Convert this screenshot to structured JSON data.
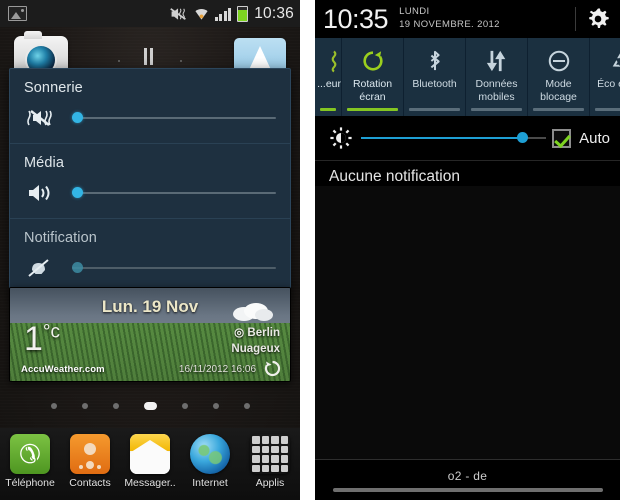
{
  "left_phone": {
    "status_bar": {
      "icons": [
        "image-icon",
        "vibrate-mute-icon",
        "wifi-icon",
        "signal-icon",
        "battery-icon"
      ],
      "clock": "10:36"
    },
    "home_icons": [
      {
        "name": "camera-icon",
        "label": ""
      },
      {
        "name": "navigation-icon",
        "label": ""
      }
    ],
    "volume_panel": {
      "rows": [
        {
          "label": "Sonnerie",
          "icon": "vibrate-mute-icon",
          "value": 4,
          "disabled": false
        },
        {
          "label": "Média",
          "icon": "speaker-icon",
          "value": 4,
          "disabled": false
        },
        {
          "label": "Notification",
          "icon": "bell-muted-icon",
          "value": 4,
          "disabled": true
        }
      ]
    },
    "weather": {
      "date": "Lun. 19 Nov",
      "temperature": "1",
      "unit": "°c",
      "city": "Berlin",
      "condition": "Nuageux",
      "brand": "AccuWeather.com",
      "updated": "16/11/2012 16:06",
      "location_icon": "target-icon",
      "refresh_icon": "refresh-icon",
      "cloud_icon": "cloud-icon"
    },
    "page_dots": {
      "count": 7,
      "active_index": 3
    },
    "dock": [
      {
        "label": "Téléphone",
        "icon": "phone-icon"
      },
      {
        "label": "Contacts",
        "icon": "contacts-icon"
      },
      {
        "label": "Messager..",
        "icon": "messaging-icon"
      },
      {
        "label": "Internet",
        "icon": "browser-icon"
      },
      {
        "label": "Applis",
        "icon": "apps-grid-icon"
      }
    ]
  },
  "right_phone": {
    "header": {
      "clock": "10:35",
      "weekday": "LUNDI",
      "date": "19 NOVEMBRE. 2012",
      "settings_icon": "gear-icon"
    },
    "toggles": [
      {
        "label": "...eur",
        "icon": "vibrate-icon",
        "active": true
      },
      {
        "label": "Rotation écran",
        "icon": "rotate-icon",
        "active": true
      },
      {
        "label": "Bluetooth",
        "icon": "bluetooth-icon",
        "active": false
      },
      {
        "label": "Données mobiles",
        "icon": "data-arrows-icon",
        "active": false
      },
      {
        "label": "Mode blocage",
        "icon": "block-icon",
        "active": false
      },
      {
        "label": "Éco énerg",
        "icon": "recycle-icon",
        "active": false
      }
    ],
    "brightness": {
      "icon": "brightness-icon",
      "value": 87,
      "auto_label": "Auto",
      "auto_checked": true
    },
    "notifications": {
      "empty_text": "Aucune notification"
    },
    "carrier": {
      "text": "o2 - de"
    }
  },
  "colors": {
    "panel_bg": "#1e3040",
    "accent_cyan": "#33b5e5",
    "accent_green": "#84c622",
    "toggle_bg": "#1b3040",
    "brightness_blue": "#1e9fd4",
    "battery_green": "#7ed321"
  }
}
